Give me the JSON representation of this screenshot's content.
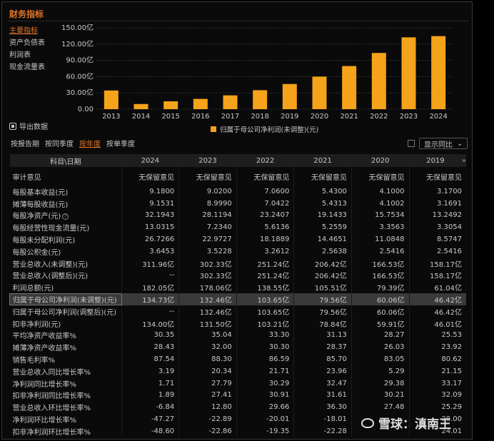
{
  "panel": {
    "title": "财务指标"
  },
  "side_nav": [
    {
      "label": "主要指标",
      "active": true
    },
    {
      "label": "资产负债表",
      "active": false
    },
    {
      "label": "利润表",
      "active": false
    },
    {
      "label": "现金流量表",
      "active": false
    }
  ],
  "export": {
    "label": "导出数据"
  },
  "tabs": [
    {
      "label": "按报告期",
      "active": false
    },
    {
      "label": "按同季度",
      "active": false
    },
    {
      "label": "按年度",
      "active": true
    },
    {
      "label": "按单季度",
      "active": false
    }
  ],
  "yoy_toggle": {
    "label": "显示同比"
  },
  "chart_data": {
    "type": "bar",
    "categories": [
      "2013",
      "2014",
      "2015",
      "2016",
      "2017",
      "2018",
      "2019",
      "2020",
      "2021",
      "2022",
      "2023",
      "2024"
    ],
    "series": [
      {
        "name": "归属于母公司净利润(未调整)(元)",
        "values": [
          34.5,
          9.5,
          14.5,
          19,
          25.5,
          35,
          46.42,
          60.06,
          79.56,
          103.65,
          132.46,
          134.73
        ]
      }
    ],
    "yticks": [
      "150.00亿",
      "120.00亿",
      "90.00亿",
      "60.00亿",
      "30.00亿",
      "0.00"
    ],
    "ylim": [
      0,
      150
    ],
    "color": "#f5a31a",
    "legend_position": "bottom"
  },
  "table": {
    "headers": [
      "科目\\日期",
      "2024",
      "2023",
      "2022",
      "2021",
      "2020",
      "2019"
    ],
    "rows": [
      {
        "label": "审计意见",
        "values": [
          "无保留意见",
          "无保留意见",
          "无保留意见",
          "无保留意见",
          "无保留意见",
          "无保留意见"
        ]
      },
      {
        "label": "每股基本收益(元)",
        "values": [
          "9.1800",
          "9.0200",
          "7.0600",
          "5.4300",
          "4.1000",
          "3.1700"
        ]
      },
      {
        "label": "摊薄每股收益(元)",
        "values": [
          "9.1531",
          "8.9990",
          "7.0422",
          "5.4313",
          "4.1002",
          "3.1691"
        ]
      },
      {
        "label": "每股净资产(元)",
        "values": [
          "32.1943",
          "28.1194",
          "23.2407",
          "19.1433",
          "15.7534",
          "13.2492"
        ],
        "info": "?"
      },
      {
        "label": "每股经营性现金流量(元)",
        "values": [
          "13.0315",
          "7.2340",
          "5.6136",
          "5.2559",
          "3.3563",
          "3.3054"
        ]
      },
      {
        "label": "每股未分配利润(元)",
        "values": [
          "26.7266",
          "22.9727",
          "18.1889",
          "14.4651",
          "11.0848",
          "8.5747"
        ]
      },
      {
        "label": "每股公积金(元)",
        "values": [
          "3.6453",
          "3.5228",
          "3.2612",
          "2.5638",
          "2.5416",
          "2.5416"
        ]
      },
      {
        "label": "营业总收入(未调整)(元)",
        "values": [
          "311.96亿",
          "302.33亿",
          "251.24亿",
          "206.42亿",
          "166.53亿",
          "158.17亿"
        ]
      },
      {
        "label": "营业总收入(调整后)(元)",
        "values": [
          "--",
          "302.33亿",
          "251.24亿",
          "206.42亿",
          "166.53亿",
          "158.17亿"
        ]
      },
      {
        "label": "利润总额(元)",
        "values": [
          "182.05亿",
          "178.06亿",
          "138.55亿",
          "105.51亿",
          "79.39亿",
          "61.04亿"
        ]
      },
      {
        "label": "归属于母公司净利润(未调整)(元)",
        "values": [
          "134.73亿",
          "132.46亿",
          "103.65亿",
          "79.56亿",
          "60.06亿",
          "46.42亿"
        ],
        "highlight": true
      },
      {
        "label": "归属于母公司净利润(调整后)(元)",
        "values": [
          "--",
          "132.46亿",
          "103.65亿",
          "79.56亿",
          "60.06亿",
          "46.42亿"
        ]
      },
      {
        "label": "扣非净利润(元)",
        "values": [
          "134.00亿",
          "131.50亿",
          "103.21亿",
          "78.84亿",
          "59.91亿",
          "46.01亿"
        ]
      },
      {
        "label": "平均净资产收益率%",
        "values": [
          "30.35",
          "35.04",
          "33.30",
          "31.13",
          "28.27",
          "25.53"
        ]
      },
      {
        "label": "摊薄净资产收益率%",
        "values": [
          "28.43",
          "32.00",
          "30.30",
          "28.37",
          "26.03",
          "23.92"
        ]
      },
      {
        "label": "销售毛利率%",
        "values": [
          "87.54",
          "88.30",
          "86.59",
          "85.70",
          "83.05",
          "80.62"
        ]
      },
      {
        "label": "营业总收入同比增长率%",
        "values": [
          "3.19",
          "20.34",
          "21.71",
          "23.96",
          "5.29",
          "21.15"
        ]
      },
      {
        "label": "净利润同比增长率%",
        "values": [
          "1.71",
          "27.79",
          "30.29",
          "32.47",
          "29.38",
          "33.17"
        ]
      },
      {
        "label": "扣非净利润同比增长率%",
        "values": [
          "1.89",
          "27.41",
          "30.91",
          "31.61",
          "30.21",
          "32.09"
        ]
      },
      {
        "label": "营业总收入环比增长率%",
        "values": [
          "-6.84",
          "12.80",
          "29.66",
          "36.30",
          "27.48",
          "25.29"
        ]
      },
      {
        "label": "净利润环比增长率%",
        "values": [
          "-47.27",
          "-22.89",
          "-20.01",
          "-18.01",
          "",
          "28.00"
        ]
      },
      {
        "label": "扣非净利润环比增长率%",
        "values": [
          "-48.60",
          "-22.86",
          "-19.35",
          "-22.28",
          "",
          "24.01"
        ]
      }
    ]
  },
  "watermark": {
    "text": "雪球：滇南王"
  }
}
